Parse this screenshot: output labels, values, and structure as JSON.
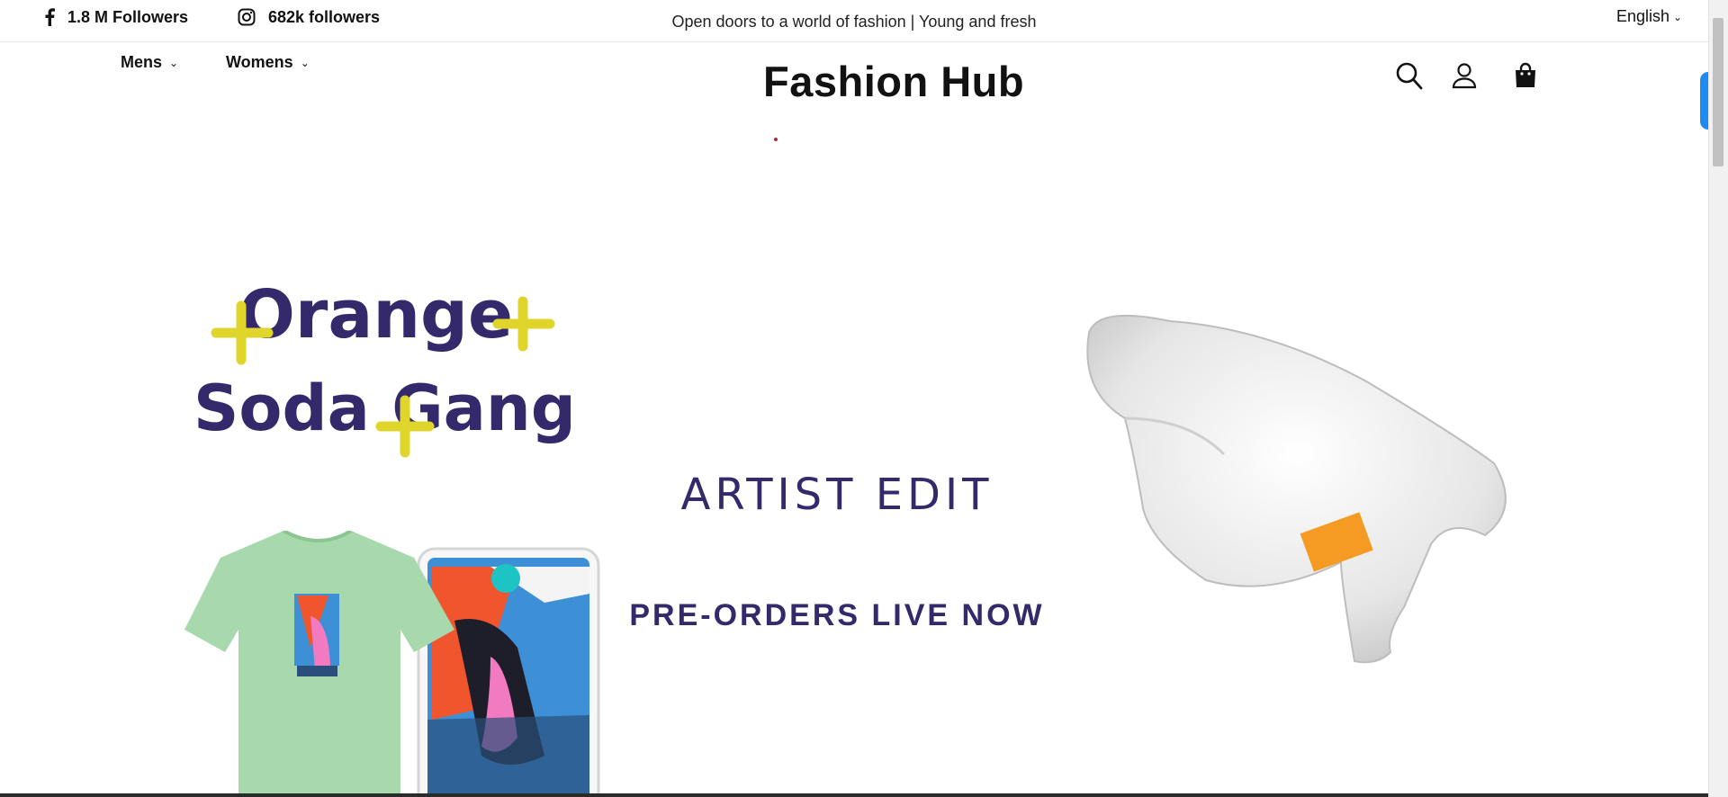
{
  "topbar": {
    "facebook": {
      "icon": "facebook-icon",
      "label": "1.8 M Followers"
    },
    "instagram": {
      "icon": "instagram-icon",
      "label": "682k followers"
    },
    "announcement": "Open doors to a world of fashion | Young and fresh",
    "language": "English"
  },
  "header": {
    "nav": [
      {
        "label": "Mens"
      },
      {
        "label": "Womens"
      }
    ],
    "brand": "Fashion Hub",
    "icons": [
      "search-icon",
      "account-icon",
      "cart-icon"
    ]
  },
  "hero": {
    "logo_line1": "Orange",
    "logo_line2": "Soda Gang",
    "heading": "ARTIST EDIT",
    "subheading": "PRE-ORDERS LIVE NOW"
  },
  "colors": {
    "brand_purple": "#34296a",
    "logo_yellow": "#e0d52a",
    "tee_green": "#a7d9ad",
    "accent_blue": "#1c8cf2"
  }
}
